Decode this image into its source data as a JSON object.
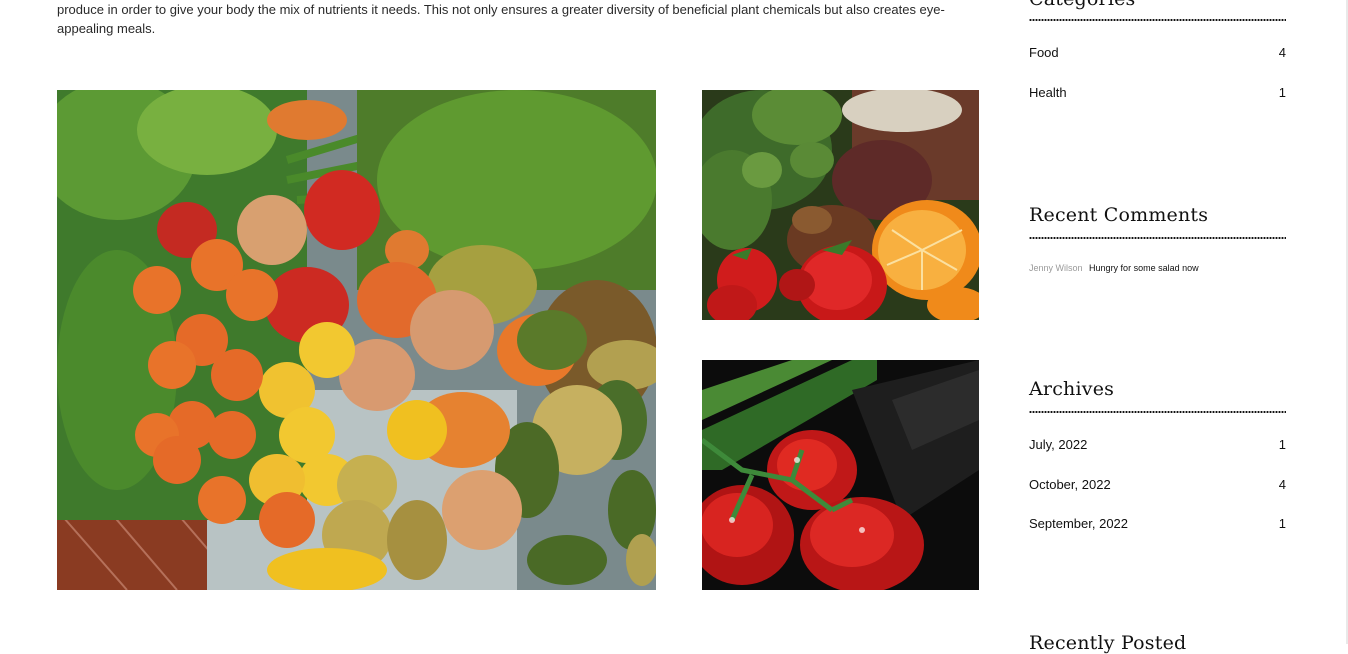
{
  "article": {
    "intro": "produce in order to give your body the mix of nutrients it needs. This not only ensures a greater diversity of beneficial plant chemicals but also creates eye-appealing meals."
  },
  "sidebar": {
    "categories": {
      "title": "Categories",
      "items": [
        {
          "label": "Food",
          "count": "4"
        },
        {
          "label": "Health",
          "count": "1"
        }
      ]
    },
    "recent_comments": {
      "title": "Recent Comments",
      "items": [
        {
          "author": "Jenny Wilson",
          "text": "Hungry for some salad now"
        }
      ]
    },
    "archives": {
      "title": "Archives",
      "items": [
        {
          "label": "July, 2022",
          "count": "1"
        },
        {
          "label": "October, 2022",
          "count": "4"
        },
        {
          "label": "September, 2022",
          "count": "1"
        }
      ]
    },
    "recently_posted": {
      "title": "Recently Posted"
    }
  }
}
